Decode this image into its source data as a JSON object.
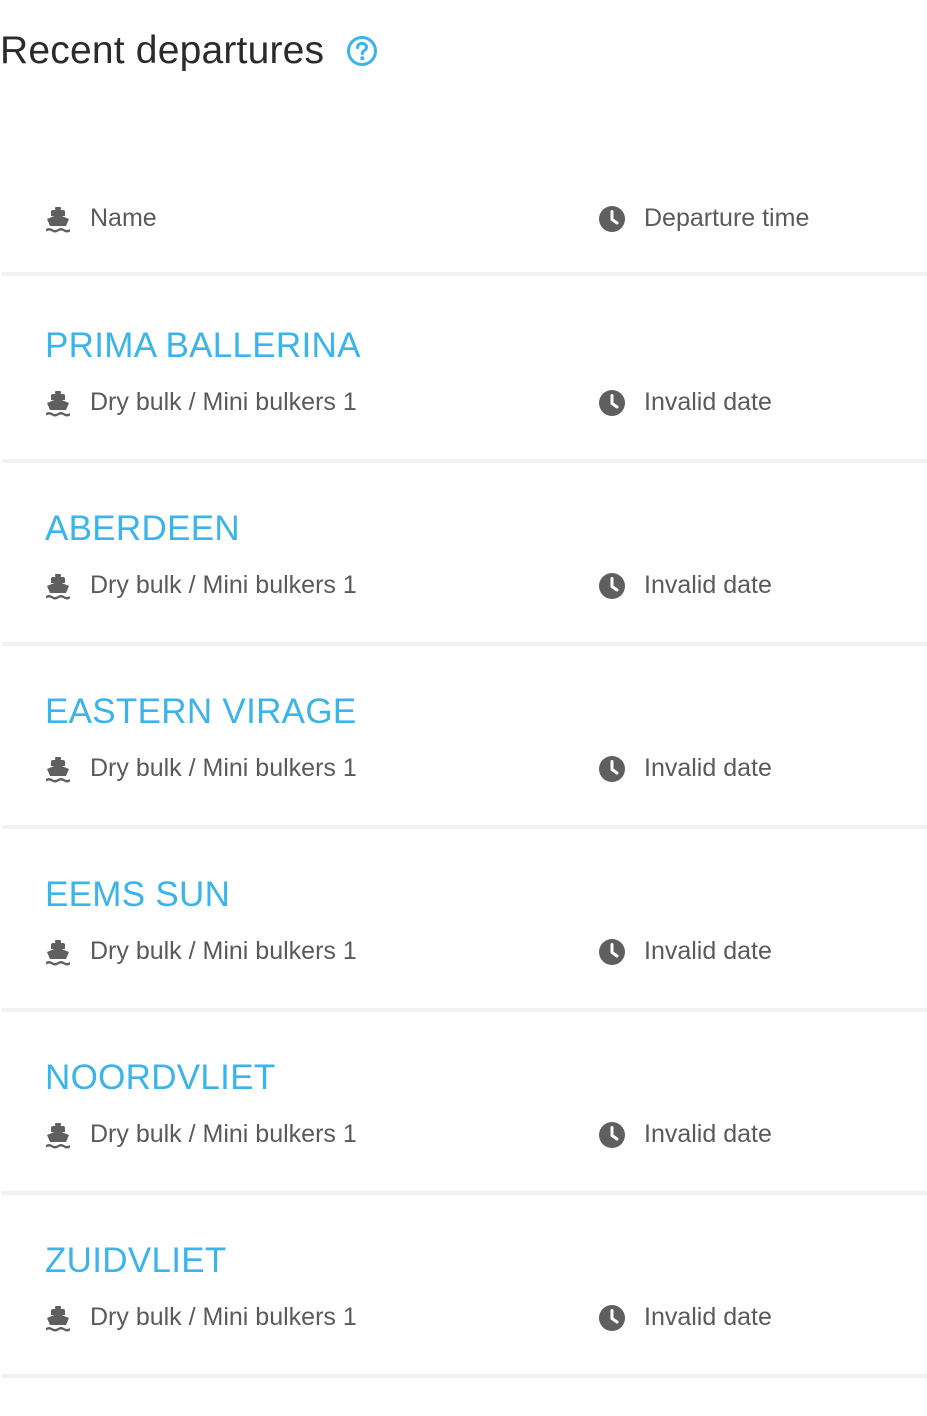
{
  "header": {
    "title": "Recent departures",
    "help_icon": "question-circle-icon"
  },
  "columns": {
    "name": {
      "label": "Name",
      "icon": "ship-icon"
    },
    "time": {
      "label": "Departure time",
      "icon": "clock-icon"
    }
  },
  "departures": [
    {
      "name": "PRIMA BALLERINA",
      "type": "Dry bulk / Mini bulkers 1",
      "time": "Invalid date"
    },
    {
      "name": "ABERDEEN",
      "type": "Dry bulk / Mini bulkers 1",
      "time": "Invalid date"
    },
    {
      "name": "EASTERN VIRAGE",
      "type": "Dry bulk / Mini bulkers 1",
      "time": "Invalid date"
    },
    {
      "name": "EEMS SUN",
      "type": "Dry bulk / Mini bulkers 1",
      "time": "Invalid date"
    },
    {
      "name": "NOORDVLIET",
      "type": "Dry bulk / Mini bulkers 1",
      "time": "Invalid date"
    },
    {
      "name": "ZUIDVLIET",
      "type": "Dry bulk / Mini bulkers 1",
      "time": "Invalid date"
    }
  ],
  "colors": {
    "accent": "#3ab4ea",
    "title": "#2b2b2b",
    "text": "#5a5a5a",
    "icon": "#5f5f5f",
    "divider": "#f1f1f1"
  }
}
